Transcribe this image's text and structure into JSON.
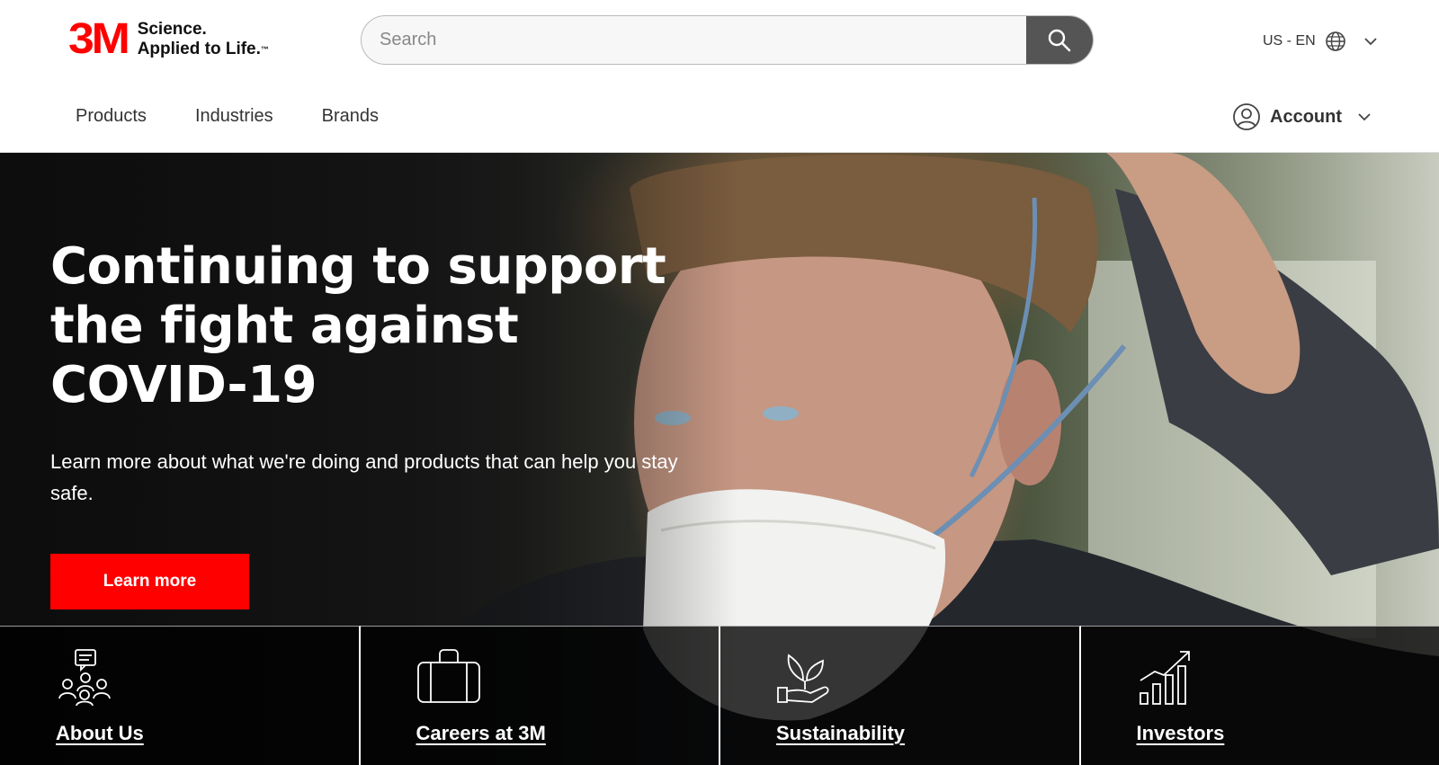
{
  "brand": {
    "logo": "3M",
    "tagline_line1": "Science.",
    "tagline_line2": "Applied to Life.",
    "trademark": "™",
    "color": "#ff0000"
  },
  "search": {
    "placeholder": "Search",
    "button_icon": "magnifier-icon"
  },
  "locale": {
    "label": "US - EN",
    "icon": "globe-icon"
  },
  "nav": {
    "items": [
      {
        "label": "Products"
      },
      {
        "label": "Industries"
      },
      {
        "label": "Brands"
      }
    ]
  },
  "account": {
    "label": "Account",
    "icon": "user-circle-icon"
  },
  "hero": {
    "title": "Continuing to support the fight against COVID-19",
    "subtitle": "Learn more about what we're doing and products that can help you stay safe.",
    "cta_label": "Learn more",
    "cta_color": "#ff0000"
  },
  "tiles": [
    {
      "label": "About Us",
      "icon": "people-chat-icon"
    },
    {
      "label": "Careers at 3M",
      "icon": "briefcase-icon"
    },
    {
      "label": "Sustainability",
      "icon": "hand-plant-icon"
    },
    {
      "label": "Investors",
      "icon": "growth-chart-icon"
    }
  ]
}
